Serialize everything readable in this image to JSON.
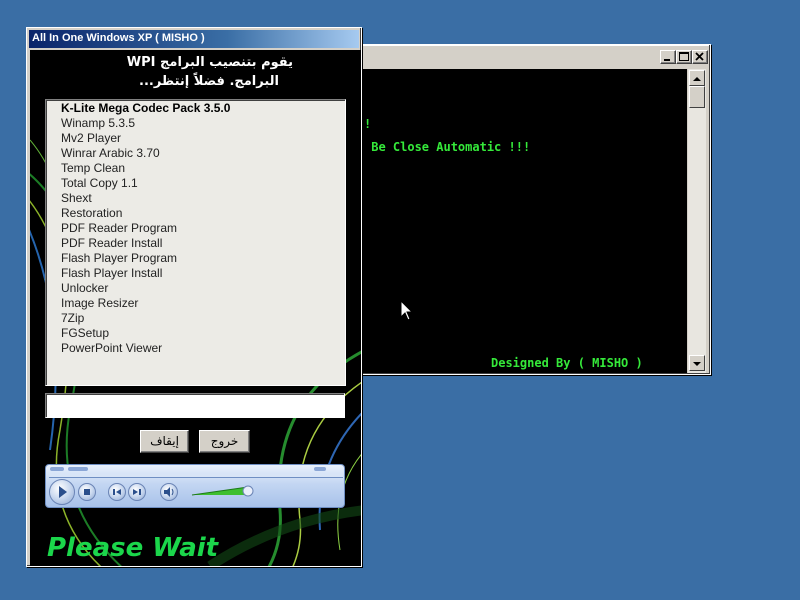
{
  "console": {
    "lines": [
      "!",
      " Be Close Automatic !!!",
      "Designed By ( MISHO )"
    ],
    "colors": {
      "background": "#000000",
      "text": "#35e93a"
    }
  },
  "installer": {
    "title": "All In One Windows XP ( MISHO )",
    "header_line1": "يقوم بتنصيب البرامج WPI",
    "header_line2": "البرامج. فضلاً إنتظر...",
    "apps": [
      "K-Lite Mega Codec Pack 3.5.0",
      "Winamp 5.3.5",
      "Mv2 Player",
      "Winrar Arabic 3.70",
      "Temp Clean",
      "Total Copy 1.1",
      "Shext",
      "Restoration",
      "PDF Reader Program",
      "PDF Reader Install",
      "Flash Player Program",
      "Flash Player Install",
      "Unlocker",
      "Image Resizer",
      "7Zip",
      "FGSetup",
      "PowerPoint Viewer"
    ],
    "progress_value": "",
    "buttons": {
      "exit": "خروج",
      "stop": "إيقاف"
    },
    "status": "Please Wait",
    "colors": {
      "status": "#1bd64b",
      "titlebar": "#0a246a"
    }
  },
  "icons": [
    "minimize-icon",
    "maximize-icon",
    "close-icon",
    "play-icon",
    "stop-icon",
    "prev-icon",
    "next-icon",
    "volume-icon",
    "mouse-cursor-icon"
  ]
}
